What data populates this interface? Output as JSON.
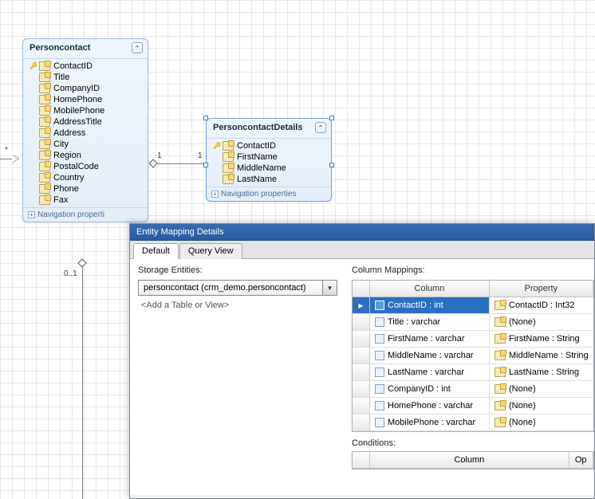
{
  "entity1": {
    "title": "Personcontact",
    "props": [
      "ContactID",
      "Title",
      "CompanyID",
      "HomePhone",
      "MobilePhone",
      "AddressTitle",
      "Address",
      "City",
      "Region",
      "PostalCode",
      "Country",
      "Phone",
      "Fax"
    ],
    "navLabel": "Navigation properti"
  },
  "entity2": {
    "title": "PersoncontactDetails",
    "props": [
      "ContactID",
      "FirstName",
      "MiddleName",
      "LastName"
    ],
    "navLabel": "Navigation properties"
  },
  "relations": {
    "left": {
      "mult1": "*",
      "mult2": "0..1"
    },
    "mid": {
      "mult1": "1",
      "mult2": "1"
    }
  },
  "panel": {
    "title": "Entity Mapping Details",
    "tabs": [
      "Default",
      "Query View"
    ],
    "storageLabel": "Storage Entities:",
    "storageValue": "personcontact (crm_demo.personcontact)",
    "addLink": "<Add a Table or View>",
    "columnMappingsLabel": "Column Mappings:",
    "headers": {
      "column": "Column",
      "property": "Property"
    },
    "rows": [
      {
        "col": "ContactID : int",
        "prop": "ContactID : Int32",
        "selected": true
      },
      {
        "col": "Title : varchar",
        "prop": "(None)"
      },
      {
        "col": "FirstName : varchar",
        "prop": "FirstName : String"
      },
      {
        "col": "MiddleName : varchar",
        "prop": "MiddleName : String"
      },
      {
        "col": "LastName : varchar",
        "prop": "LastName : String"
      },
      {
        "col": "CompanyID : int",
        "prop": "(None)"
      },
      {
        "col": "HomePhone : varchar",
        "prop": "(None)"
      },
      {
        "col": "MobilePhone : varchar",
        "prop": "(None)"
      }
    ],
    "conditionsLabel": "Conditions:",
    "condHeaders": {
      "column": "Column",
      "op": "Op"
    }
  }
}
